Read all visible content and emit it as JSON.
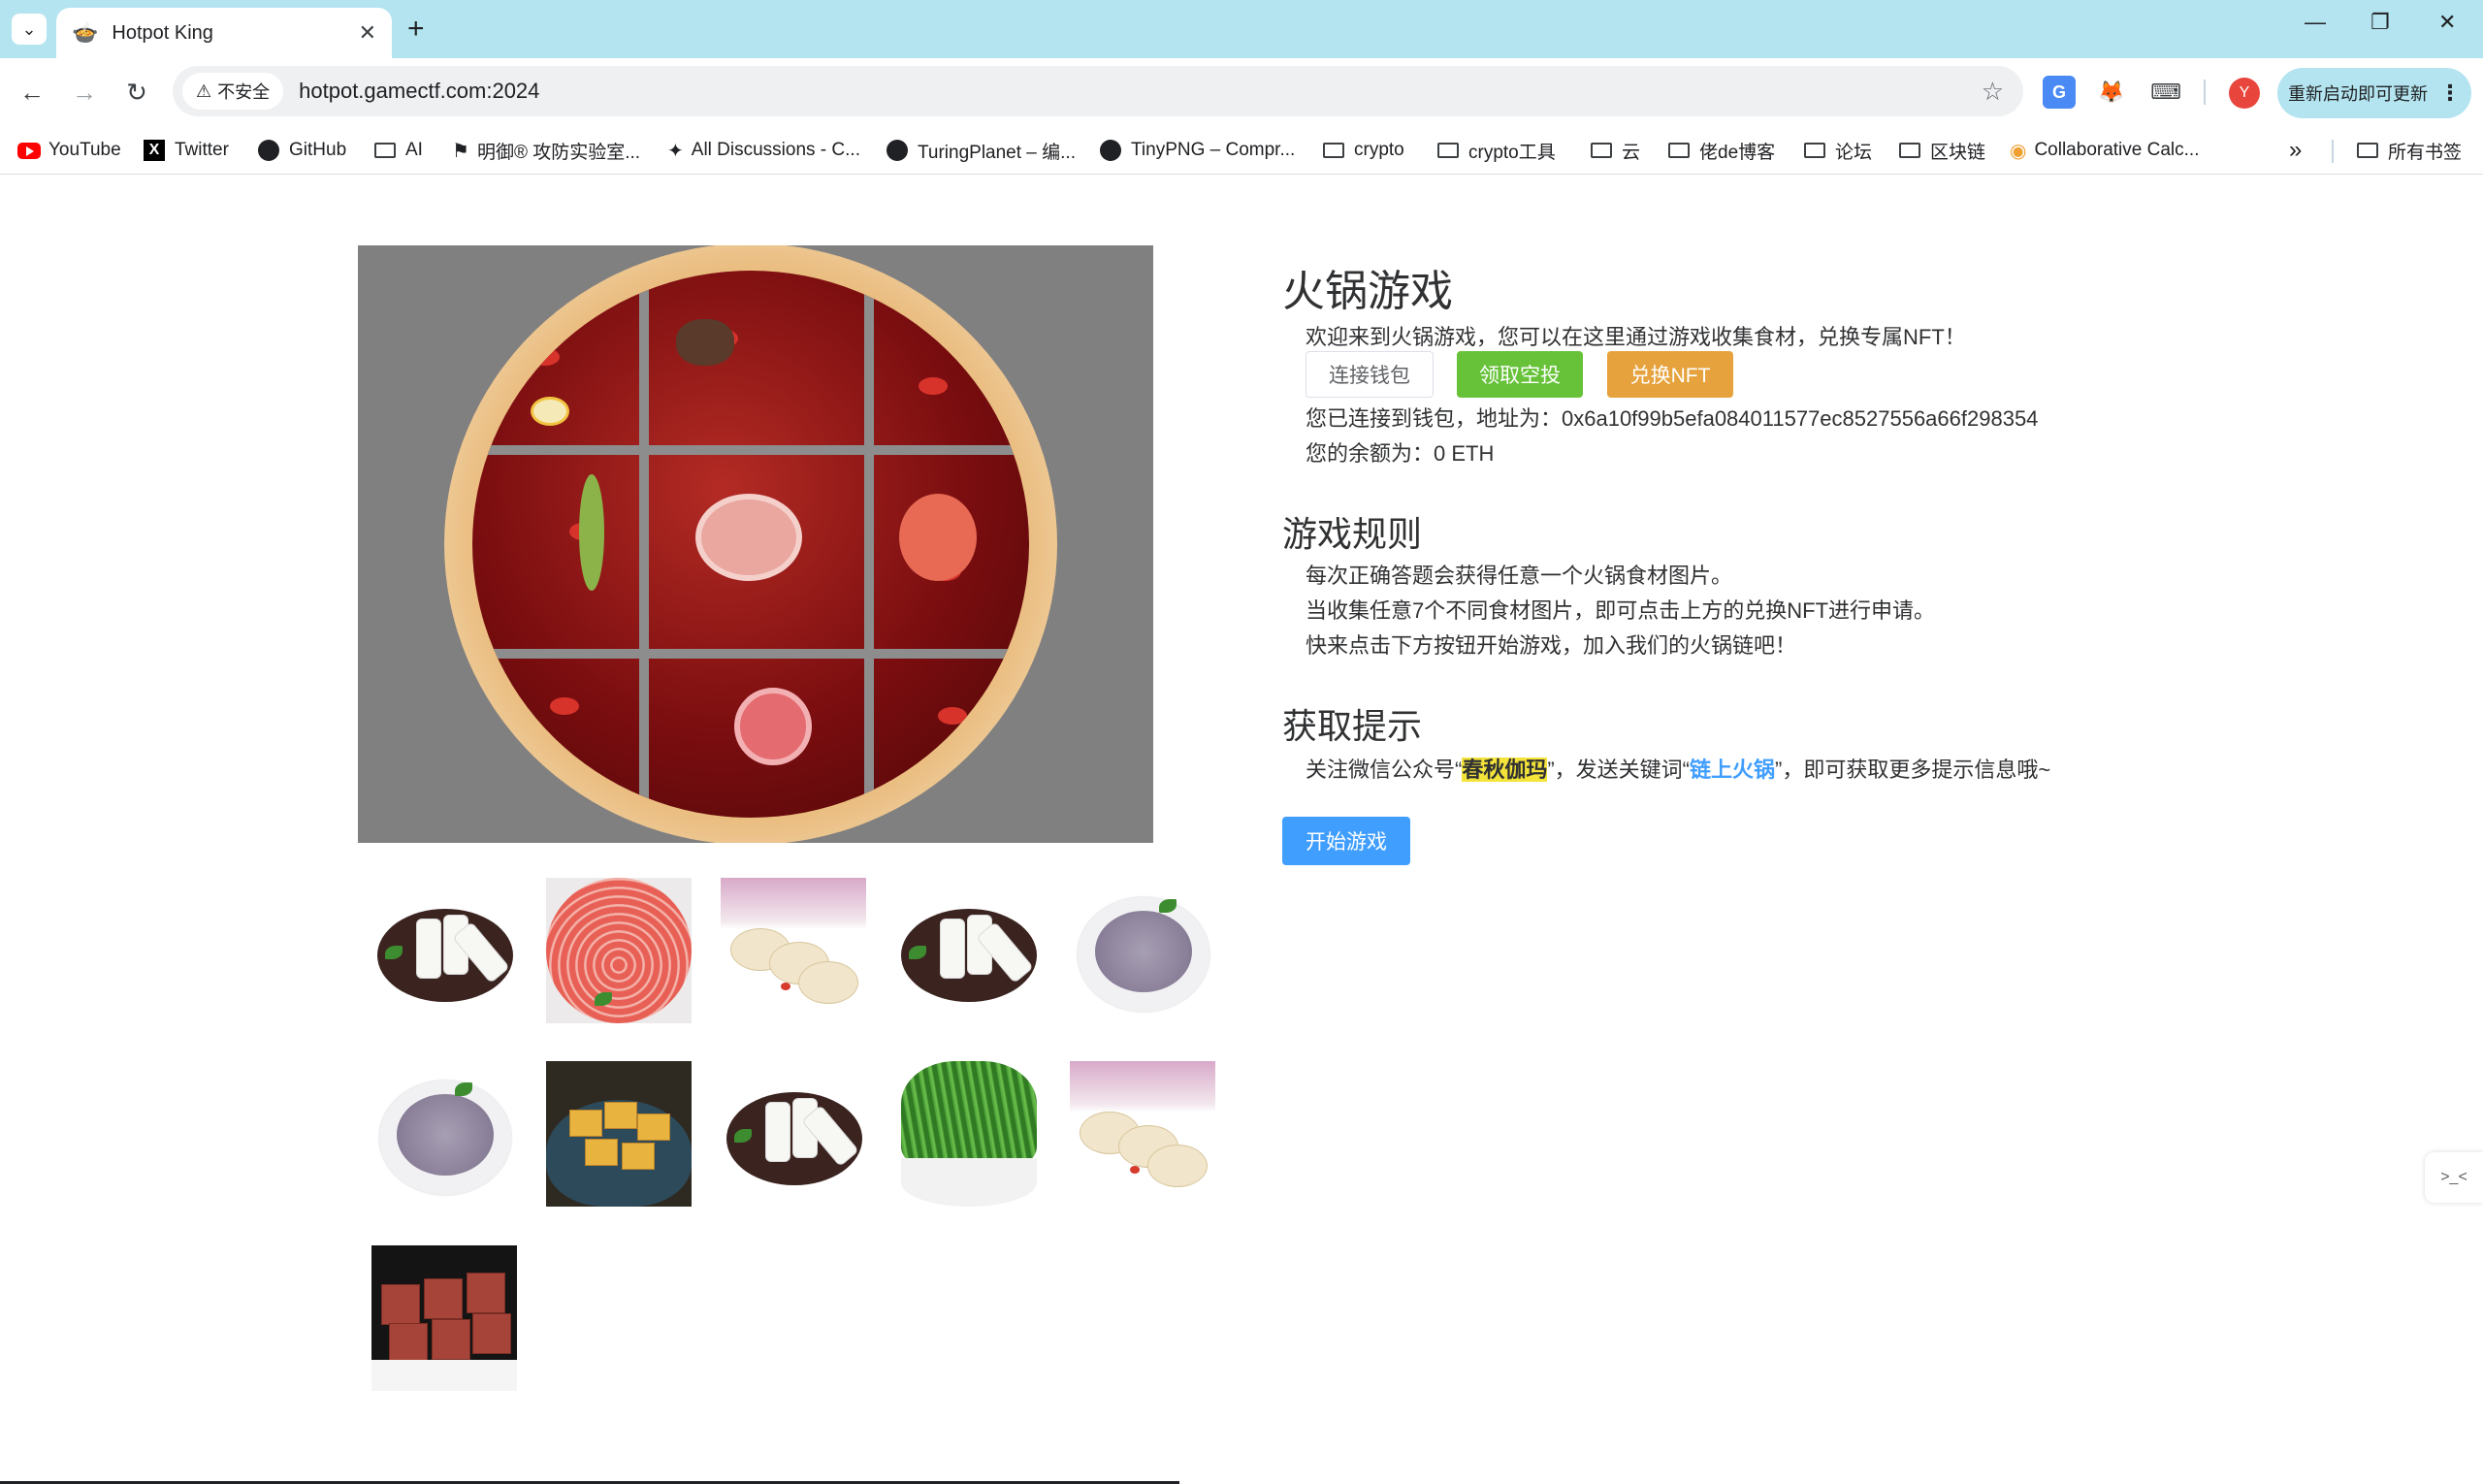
{
  "browser": {
    "tab_title": "Hotpot King",
    "tab_favicon": "hotpot-icon",
    "new_tab": "+",
    "url_security": "不安全",
    "url": "hotpot.gamectf.com:2024",
    "avatar_letter": "Y",
    "update_label": "重新启动即可更新",
    "bookmarks": [
      {
        "label": "YouTube",
        "icon": "youtube-icon"
      },
      {
        "label": "Twitter",
        "icon": "x-icon"
      },
      {
        "label": "GitHub",
        "icon": "github-icon"
      },
      {
        "label": "AI",
        "icon": "folder-icon"
      },
      {
        "label": "明御® 攻防实验室...",
        "icon": "site-icon"
      },
      {
        "label": "All Discussions - C...",
        "icon": "site-icon"
      },
      {
        "label": "TuringPlanet – 编...",
        "icon": "site-icon"
      },
      {
        "label": "TinyPNG – Compr...",
        "icon": "site-icon"
      },
      {
        "label": "crypto",
        "icon": "folder-icon"
      },
      {
        "label": "crypto工具",
        "icon": "folder-icon"
      },
      {
        "label": "云",
        "icon": "folder-icon"
      },
      {
        "label": "佬de博客",
        "icon": "folder-icon"
      },
      {
        "label": "论坛",
        "icon": "folder-icon"
      },
      {
        "label": "区块链",
        "icon": "folder-icon"
      },
      {
        "label": "Collaborative Calc...",
        "icon": "site-icon"
      }
    ],
    "more_bookmarks": "»",
    "all_bookmarks": "所有书签"
  },
  "page": {
    "title": "火锅游戏",
    "welcome": "欢迎来到火锅游戏，您可以在这里通过游戏收集食材，兑换专属NFT！",
    "buttons": {
      "connect": "连接钱包",
      "airdrop": "领取空投",
      "redeem": "兑换NFT",
      "start": "开始游戏"
    },
    "wallet_line": "您已连接到钱包，地址为：0x6a10f99b5efa084011577ec8527556a66f298354",
    "balance_line": "您的余额为：0 ETH",
    "rules": {
      "heading": "游戏规则",
      "items": [
        "每次正确答题会获得任意一个火锅食材图片。",
        "当收集任意7个不同食材图片，即可点击上方的兑换NFT进行申请。",
        "快来点击下方按钮开始游戏，加入我们的火锅链吧！"
      ]
    },
    "hints": {
      "heading": "获取提示",
      "prefix": "关注微信公众号“",
      "account": "春秋伽玛",
      "middle": "”，发送关键词“",
      "keyword": "链上火锅",
      "suffix": "”，即可获取更多提示信息哦~"
    },
    "ingredients": [
      "rice-cake",
      "beef-slices",
      "lotus-root",
      "rice-cake",
      "taro-paste",
      "taro-paste",
      "fried-tofu",
      "rice-cake",
      "greens",
      "lotus-root",
      "duck-blood"
    ]
  },
  "colors": {
    "primary": "#409eff",
    "success": "#67c23a",
    "warning": "#e6a23c",
    "highlight": "#f4e43a",
    "tabstrip": "#b3e4ef"
  }
}
